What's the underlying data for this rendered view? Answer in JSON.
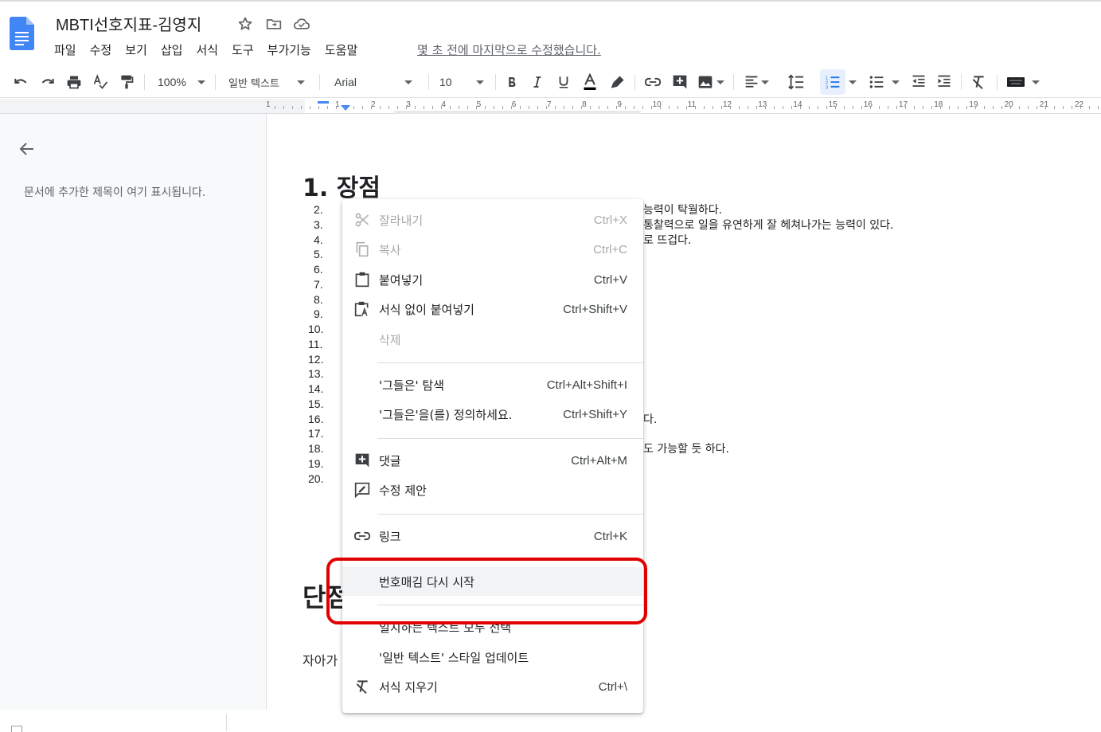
{
  "document": {
    "title": "MBTI선호지표-김영지",
    "last_edit": "몇 초 전에 마지막으로 수정했습니다."
  },
  "menubar": [
    "파일",
    "수정",
    "보기",
    "삽입",
    "서식",
    "도구",
    "부가기능",
    "도움말"
  ],
  "toolbar": {
    "zoom": "100%",
    "style": "일반 텍스트",
    "font": "Arial",
    "font_size": "10"
  },
  "ruler": {
    "numbers": [
      "1",
      "1",
      "2",
      "3",
      "4",
      "5",
      "6",
      "7",
      "8",
      "9",
      "10",
      "11",
      "12",
      "13",
      "14",
      "15",
      "16",
      "17",
      "18",
      "19",
      "20",
      "21",
      "22"
    ]
  },
  "outline": {
    "empty_text": "문서에 추가한 제목이 여기 표시됩니다."
  },
  "doc": {
    "heading1": "1.   장점",
    "heading2": "단점",
    "para_start": "자아가",
    "list_numbers": [
      "2.",
      "3.",
      "4.",
      "5.",
      "6.",
      "7.",
      "8.",
      "9.",
      "10.",
      "11.",
      "12.",
      "13.",
      "14.",
      "15.",
      "16.",
      "17.",
      "18.",
      "19.",
      "20."
    ],
    "line_a": "능력이 탁월하다.",
    "line_b": "통찰력으로 일을 유연하게 잘 헤쳐나가는 능력이 있다.",
    "line_c": "로 뜨겁다.",
    "line_d": "다.",
    "line_e": "도 가능할 듯 하다."
  },
  "context_menu": {
    "items": [
      {
        "label": "잘라내기",
        "shortcut": "Ctrl+X",
        "icon": "scissors-icon",
        "disabled": true
      },
      {
        "label": "복사",
        "shortcut": "Ctrl+C",
        "icon": "copy-icon",
        "disabled": true
      },
      {
        "label": "붙여넣기",
        "shortcut": "Ctrl+V",
        "icon": "clipboard-icon",
        "disabled": false
      },
      {
        "label": "서식 없이 붙여넣기",
        "shortcut": "Ctrl+Shift+V",
        "icon": "paste-plain-icon",
        "disabled": false
      },
      {
        "label": "삭제",
        "shortcut": "",
        "icon": "",
        "disabled": true
      },
      {
        "label": "'그들은' 탐색",
        "shortcut": "Ctrl+Alt+Shift+I",
        "icon": "",
        "disabled": false
      },
      {
        "label": "'그들은'을(를) 정의하세요.",
        "shortcut": "Ctrl+Shift+Y",
        "icon": "",
        "disabled": false
      },
      {
        "label": "댓글",
        "shortcut": "Ctrl+Alt+M",
        "icon": "add-comment-icon",
        "disabled": false
      },
      {
        "label": "수정 제안",
        "shortcut": "",
        "icon": "suggest-edit-icon",
        "disabled": false
      },
      {
        "label": "링크",
        "shortcut": "Ctrl+K",
        "icon": "link-icon",
        "disabled": false
      },
      {
        "label": "번호매김 다시 시작",
        "shortcut": "",
        "icon": "",
        "disabled": false
      },
      {
        "label": "일치하는 텍스트 모두 선택",
        "shortcut": "",
        "icon": "",
        "disabled": false
      },
      {
        "label": "'일반 텍스트' 스타일 업데이트",
        "shortcut": "",
        "icon": "",
        "disabled": false
      },
      {
        "label": "서식 지우기",
        "shortcut": "Ctrl+\\",
        "icon": "clear-format-icon",
        "disabled": false
      }
    ]
  }
}
